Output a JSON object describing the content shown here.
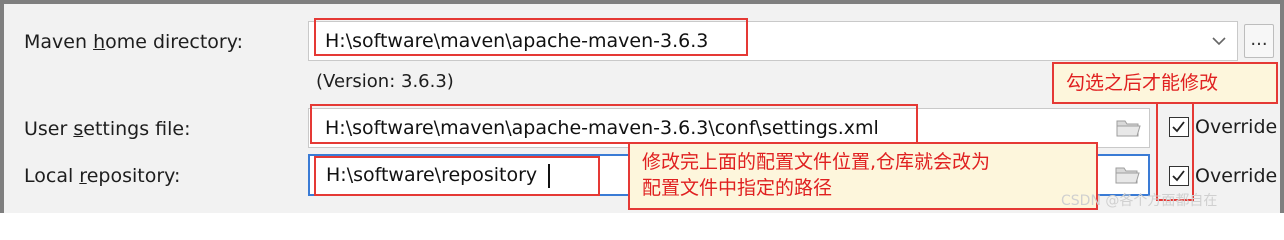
{
  "maven_home": {
    "label_pre": "Maven ",
    "label_key": "h",
    "label_post": "ome directory:",
    "value": "H:\\software\\maven\\apache-maven-3.6.3",
    "version": "(Version: 3.6.3)",
    "browse_label": "..."
  },
  "user_settings": {
    "label_pre": "User ",
    "label_key": "s",
    "label_post": "ettings file:",
    "value": "H:\\software\\maven\\apache-maven-3.6.3\\conf\\settings.xml",
    "override_label": "Override",
    "override_checked": true
  },
  "local_repo": {
    "label_pre": "Local ",
    "label_key": "r",
    "label_post": "epository:",
    "value": "H:\\software\\repository",
    "override_label": "Override",
    "override_checked": true
  },
  "annotations": {
    "checkbox_note": "勾选之后才能修改",
    "repo_note_line1": "修改完上面的配置文件位置,仓库就会改为",
    "repo_note_line2": "配置文件中指定的路径"
  },
  "watermark": "CSDN @各个方面都自在",
  "colors": {
    "accent_red": "#e53935",
    "focus_blue": "#3a7bd5",
    "note_bg": "#fdf6dc"
  }
}
